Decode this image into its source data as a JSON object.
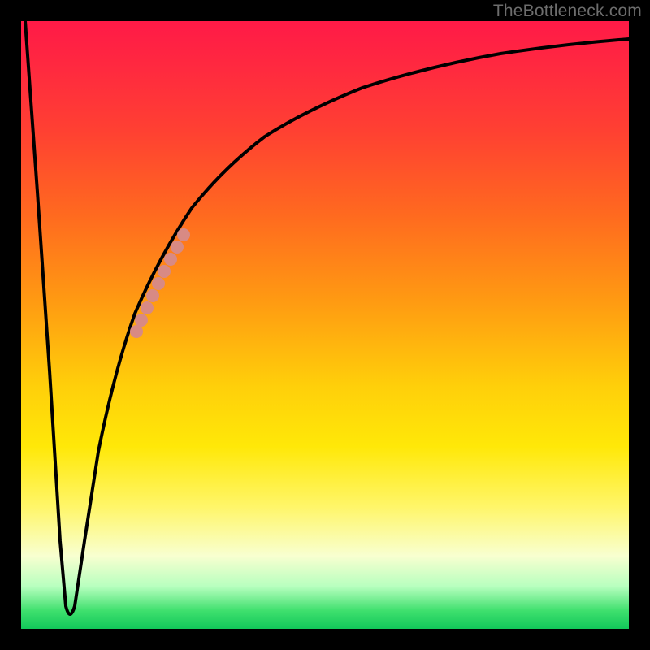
{
  "watermark": "TheBottleneck.com",
  "colors": {
    "background_black": "#000000",
    "gradient_top": "#ff1a47",
    "gradient_bottom": "#12c85a",
    "curve_stroke": "#000000",
    "marker_fill": "#d88a84"
  },
  "chart_data": {
    "type": "line",
    "title": "",
    "xlabel": "",
    "ylabel": "",
    "xlim": [
      0,
      100
    ],
    "ylim": [
      0,
      100
    ],
    "series": [
      {
        "name": "main-curve",
        "x": [
          0,
          2,
          4,
          6,
          7,
          8,
          9,
          10,
          12,
          15,
          18,
          22,
          26,
          30,
          35,
          40,
          48,
          58,
          70,
          85,
          100
        ],
        "y": [
          100,
          70,
          40,
          12,
          3,
          1,
          3,
          12,
          28,
          42,
          52,
          62,
          70,
          75,
          80,
          84,
          88,
          91,
          93.5,
          95,
          96
        ]
      },
      {
        "name": "highlight-markers",
        "x": [
          18.5,
          19.5,
          20.5,
          21.5,
          22.5,
          23.5,
          24.5,
          25.5
        ],
        "y": [
          49.0,
          51.0,
          53.0,
          56.0,
          58.8,
          61.4,
          64.0,
          66.5
        ]
      }
    ]
  }
}
